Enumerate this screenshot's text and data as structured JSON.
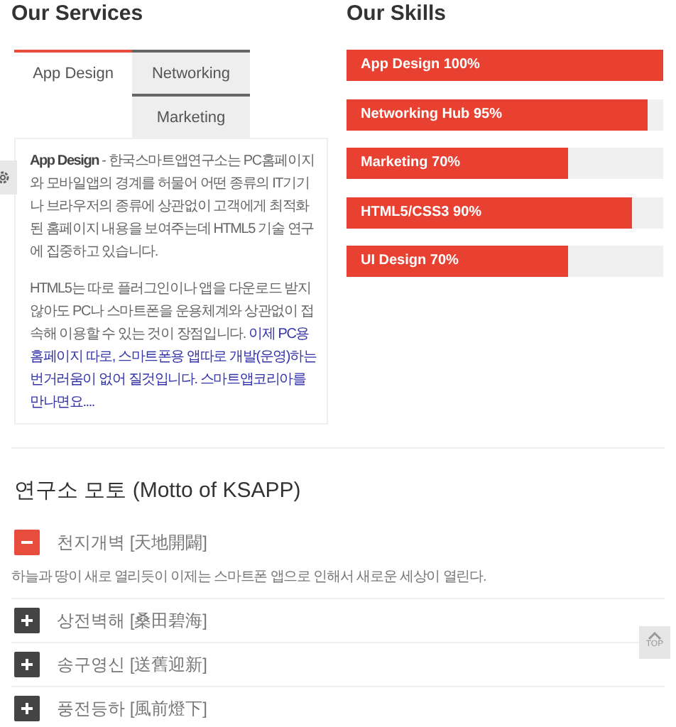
{
  "services": {
    "title": "Our Services",
    "tabs": [
      {
        "label": "App Design",
        "selected": true
      },
      {
        "label": "Networking",
        "selected": false
      },
      {
        "label": "Marketing",
        "selected": false
      }
    ],
    "content": {
      "lead": "App Design",
      "intro": " - 한국스마트앱연구소는 PC홈페이지와 모바일앱의 경계를 허물어 어떤 종류의 IT기기나 브라우저의 종류에 상관없이 고객에게 최적화된 홈페이지 내용을 보여주는데 HTML5 기술 연구에 집중하고 있습니다.",
      "text": "HTML5는 따로 플러그인이나 앱을 다운로드 받지 않아도 PC나 스마트폰을 운용체계와 상관없이 접속해 이용할 수 있는 것이 장점입니다. ",
      "highlight": "이제 PC용 홈페이지 따로, 스마트폰용 앱따로 개발(운영)하는 번거러움이 없어 질것입니다. 스마트앱코리아를 만나면요...."
    }
  },
  "skills": {
    "title": "Our Skills",
    "bars": [
      {
        "label": "App Design 100%",
        "level": 1.0
      },
      {
        "label": "Networking Hub 95%",
        "level": 0.95
      },
      {
        "label": "Marketing 70%",
        "level": 0.7
      },
      {
        "label": "HTML5/CSS3 90%",
        "level": 0.9
      },
      {
        "label": "UI Design 70%",
        "level": 0.7
      }
    ]
  },
  "motto": {
    "title": "연구소 모토 (Motto of KSAPP)",
    "items": [
      {
        "title": "천지개벽 [天地開闢]",
        "expanded": true,
        "body": "하늘과 땅이 새로 열리듯이 이제는 스마트폰 앱으로 인해서 새로운 세상이 열린다."
      },
      {
        "title": "상전벽해 [桑田碧海]",
        "expanded": false
      },
      {
        "title": "송구영신 [送舊迎新]",
        "expanded": false
      },
      {
        "title": "풍전등하 [風前燈下]",
        "expanded": false
      }
    ]
  },
  "top_button": "TOP"
}
